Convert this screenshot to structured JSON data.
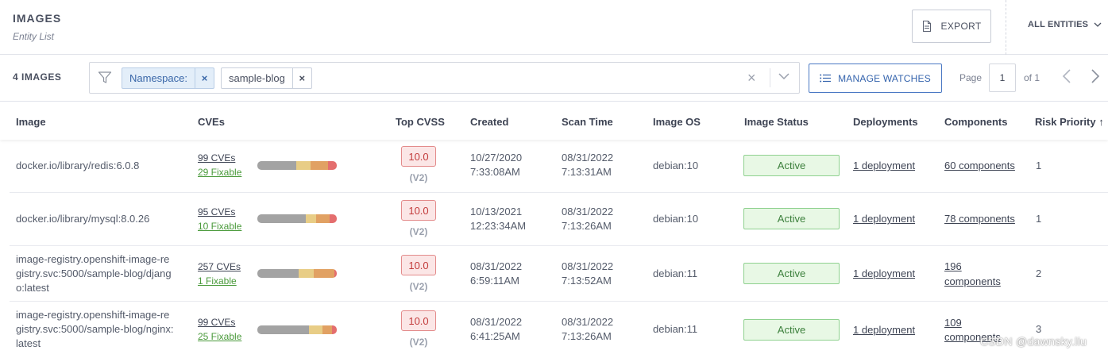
{
  "header": {
    "title": "IMAGES",
    "subtitle": "Entity List",
    "export_label": "EXPORT",
    "entities_label": "ALL ENTITIES"
  },
  "toolbar": {
    "count_label": "4 IMAGES",
    "chips": [
      {
        "label": "Namespace:",
        "remove": "×"
      },
      {
        "label": "sample-blog",
        "remove": "×"
      }
    ],
    "clear_symbol": "×",
    "manage_watches_label": "MANAGE WATCHES",
    "page_label": "Page",
    "page_value": "1",
    "of_label": "of 1"
  },
  "columns": [
    "Image",
    "CVEs",
    "Top CVSS",
    "Created",
    "Scan Time",
    "Image OS",
    "Image Status",
    "Deployments",
    "Components",
    "Risk Priority ↑"
  ],
  "rows": [
    {
      "image": "docker.io/library/redis:6.0.8",
      "cves": "99 CVEs",
      "fixable": "29 Fixable",
      "severity": {
        "low": 0.49,
        "medium": 0.18,
        "high": 0.22,
        "critical": 0.11
      },
      "cvss": "10.0",
      "cvss_version": "(V2)",
      "created_date": "10/27/2020",
      "created_time": "7:33:08AM",
      "scan_date": "08/31/2022",
      "scan_time": "7:13:31AM",
      "os": "debian:10",
      "status": "Active",
      "deployments": "1 deployment",
      "components": "60 components",
      "risk": "1"
    },
    {
      "image": "docker.io/library/mysql:8.0.26",
      "cves": "95 CVEs",
      "fixable": "10 Fixable",
      "severity": {
        "low": 0.61,
        "medium": 0.13,
        "high": 0.17,
        "critical": 0.09
      },
      "cvss": "10.0",
      "cvss_version": "(V2)",
      "created_date": "10/13/2021",
      "created_time": "12:23:34AM",
      "scan_date": "08/31/2022",
      "scan_time": "7:13:26AM",
      "os": "debian:10",
      "status": "Active",
      "deployments": "1 deployment",
      "components": "78 components",
      "risk": "1"
    },
    {
      "image": "image-registry.openshift-image-registry.svc:5000/sample-blog/django:latest",
      "image_lines": [
        "image-registry.openshift-image-re",
        "gistry.svc:5000/sample-blog/djang",
        "o:latest"
      ],
      "cves": "257 CVEs",
      "fixable": "1 Fixable",
      "severity": {
        "low": 0.52,
        "medium": 0.19,
        "high": 0.26,
        "critical": 0.03
      },
      "cvss": "10.0",
      "cvss_version": "(V2)",
      "created_date": "08/31/2022",
      "created_time": "6:59:11AM",
      "scan_date": "08/31/2022",
      "scan_time": "7:13:52AM",
      "os": "debian:11",
      "status": "Active",
      "deployments": "1 deployment",
      "components_lines": [
        "196",
        "components"
      ],
      "risk": "2"
    },
    {
      "image": "image-registry.openshift-image-registry.svc:5000/sample-blog/nginx:latest",
      "image_lines": [
        "image-registry.openshift-image-re",
        "gistry.svc:5000/sample-blog/nginx:",
        "latest"
      ],
      "cves": "99 CVEs",
      "fixable": "25 Fixable",
      "severity": {
        "low": 0.65,
        "medium": 0.17,
        "high": 0.12,
        "critical": 0.06
      },
      "cvss": "10.0",
      "cvss_version": "(V2)",
      "created_date": "08/31/2022",
      "created_time": "6:41:25AM",
      "scan_date": "08/31/2022",
      "scan_time": "7:13:26AM",
      "os": "debian:11",
      "status": "Active",
      "deployments": "1 deployment",
      "components_lines": [
        "109",
        "components"
      ],
      "risk": "3"
    }
  ],
  "watermark": "CSDN @dawnsky.liu",
  "colors": {
    "accent": "#3564ad",
    "active": "#3b7f3b",
    "critical": "#c23a3a"
  }
}
